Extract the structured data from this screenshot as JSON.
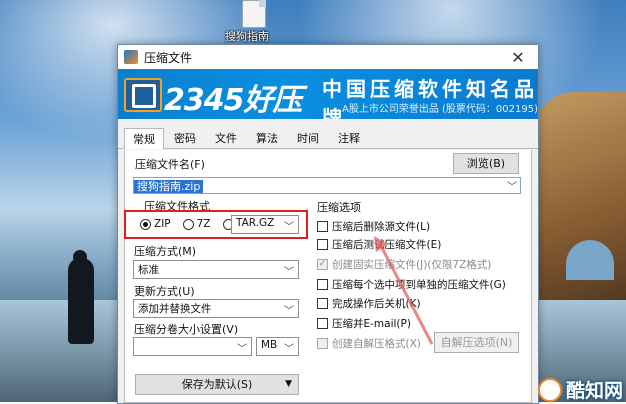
{
  "desktop": {
    "icon_label": "搜狗指南"
  },
  "window": {
    "title": "压缩文件",
    "close_glyph": "✕"
  },
  "banner": {
    "brand": "2345好压",
    "slogan": "中国压缩软件知名品牌",
    "subslogan": "A股上市公司荣誉出品 (股票代码：002195)"
  },
  "tabs": [
    "常规",
    "密码",
    "文件",
    "算法",
    "时间",
    "注释"
  ],
  "general": {
    "filename_label": "压缩文件名(F)",
    "browse_label": "浏览(B)",
    "filename_value": "搜狗指南.zip",
    "format_label": "压缩文件格式",
    "formats": [
      {
        "label": "ZIP",
        "selected": true
      },
      {
        "label": "7Z",
        "selected": false
      },
      {
        "label": "",
        "selected": false
      }
    ],
    "format_extra_select": "TAR.GZ",
    "method_label": "压缩方式(M)",
    "method_value": "标准",
    "update_label": "更新方式(U)",
    "update_value": "添加并替换文件",
    "split_label": "压缩分卷大小设置(V)",
    "split_value": "",
    "split_unit": "MB",
    "save_default_label": "保存为默认(S)",
    "options_title": "压缩选项",
    "options": [
      {
        "label": "压缩后删除源文件(L)",
        "checked": false,
        "disabled": false
      },
      {
        "label": "压缩后测试压缩文件(E)",
        "checked": false,
        "disabled": false
      },
      {
        "label": "创建固实压缩文件(J)(仅限7Z格式)",
        "checked": true,
        "disabled": true
      },
      {
        "label": "压缩每个选中项到单独的压缩文件(G)",
        "checked": false,
        "disabled": false
      },
      {
        "label": "完成操作后关机(K)",
        "checked": false,
        "disabled": false
      },
      {
        "label": "压缩并E-mail(P)",
        "checked": false,
        "disabled": false
      },
      {
        "label": "创建自解压格式(X)",
        "checked": false,
        "disabled": true
      }
    ],
    "sfx_options_label": "自解压选项(N)"
  },
  "watermark": {
    "text": "酷知网"
  },
  "colors": {
    "banner": "#0a8fe0",
    "highlight_box": "#e02020",
    "selection": "#2a72d3"
  }
}
